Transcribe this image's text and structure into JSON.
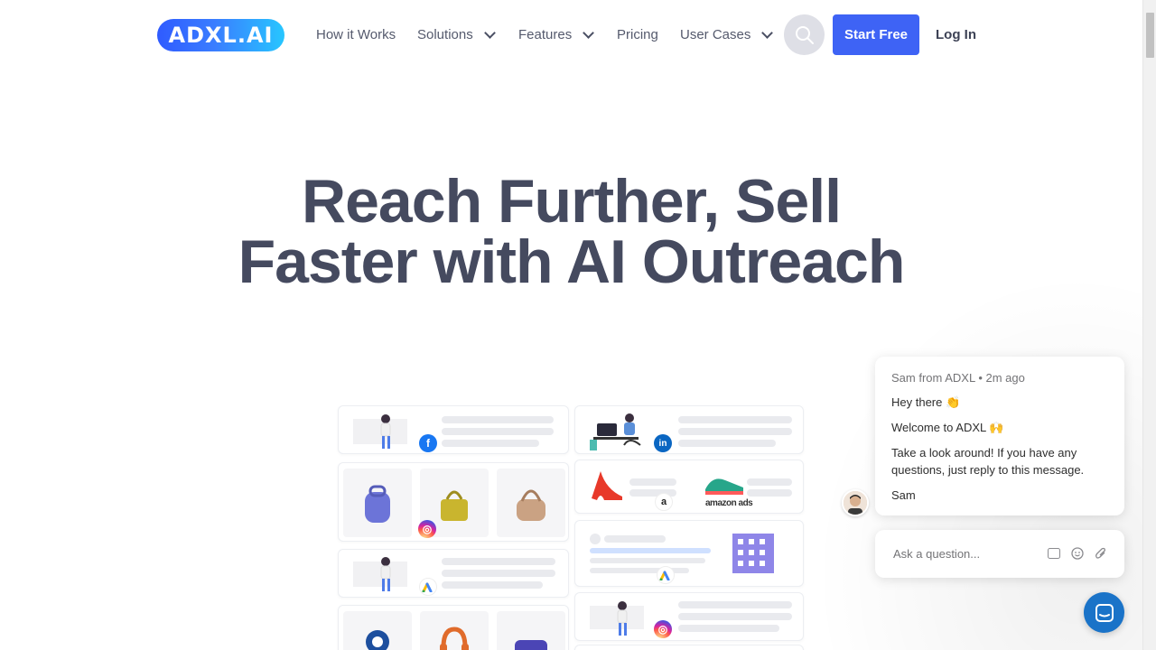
{
  "brand": {
    "logo_text": "ADXL.AI"
  },
  "nav": {
    "items": [
      {
        "label": "How it Works",
        "has_dropdown": false
      },
      {
        "label": "Solutions",
        "has_dropdown": true
      },
      {
        "label": "Features",
        "has_dropdown": true
      },
      {
        "label": "Pricing",
        "has_dropdown": false
      },
      {
        "label": "User Cases",
        "has_dropdown": true
      }
    ],
    "search_icon": "search-icon",
    "cta_label": "Start Free",
    "login_label": "Log In"
  },
  "hero": {
    "title_line1": "Reach Further, Sell",
    "title_line2": "Faster with AI Outreach"
  },
  "showcase": {
    "amazon_ads_label": "amazon ads"
  },
  "chat": {
    "meta": "Sam from ADXL • 2m ago",
    "greeting": "Hey there 👏",
    "welcome": "Welcome to ADXL 🙌",
    "message": "Take a look around! If you have any questions, just reply to this message.",
    "signature": "Sam",
    "input_placeholder": "Ask a question...",
    "gif_label": "GIF"
  },
  "colors": {
    "primary": "#3e63f5",
    "heading": "#454a5f",
    "launcher": "#1a73c8"
  }
}
